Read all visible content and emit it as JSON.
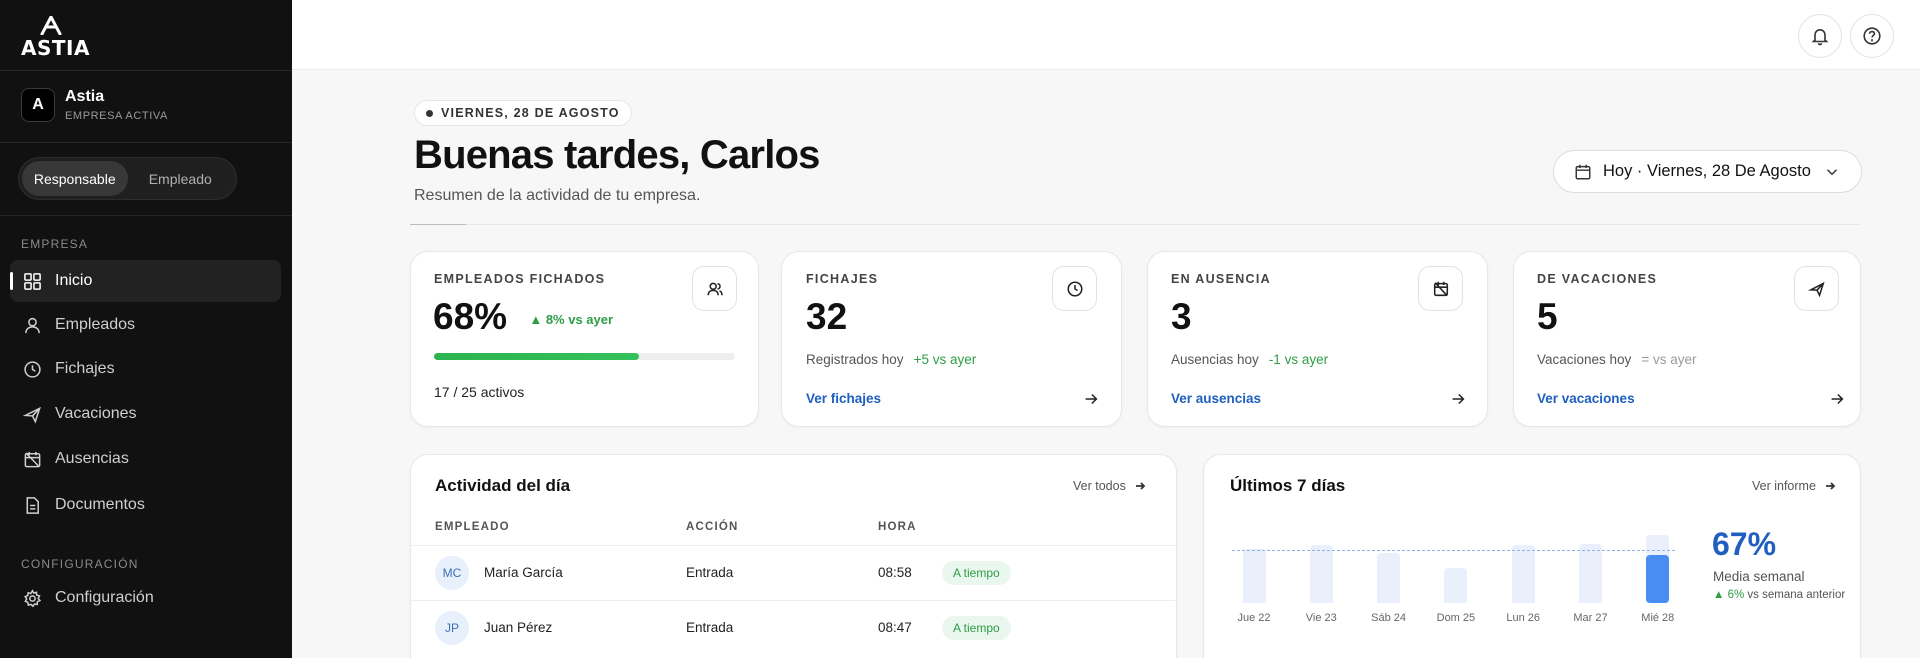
{
  "brand": {
    "logo_text": "ASTIA"
  },
  "company": {
    "avatar_letter": "A",
    "name": "Astia",
    "status": "EMPRESA ACTIVA"
  },
  "role_toggle": {
    "options": [
      "Responsable",
      "Empleado"
    ],
    "selected": "Responsable"
  },
  "sidebar": {
    "section_company": "EMPRESA",
    "items": [
      {
        "label": "Inicio",
        "icon": "grid-icon",
        "active": true
      },
      {
        "label": "Empleados",
        "icon": "user-icon"
      },
      {
        "label": "Fichajes",
        "icon": "clock-icon"
      },
      {
        "label": "Vacaciones",
        "icon": "plane-icon"
      },
      {
        "label": "Ausencias",
        "icon": "calendar-x-icon"
      },
      {
        "label": "Documentos",
        "icon": "document-icon"
      }
    ],
    "section_config": "CONFIGURACIÓN",
    "config_item": {
      "label": "Configuración",
      "icon": "gear-icon"
    }
  },
  "topbar": {
    "icons": [
      "bell-icon",
      "help-icon"
    ]
  },
  "header": {
    "date_pill": "VIERNES, 28 DE AGOSTO",
    "greeting": "Buenas tardes, Carlos",
    "subtitle": "Resumen de la actividad de tu empresa.",
    "date_select": "Hoy · Viernes, 28 De Agosto"
  },
  "kpis": {
    "employees": {
      "label": "EMPLEADOS FICHADOS",
      "value": "68%",
      "trend": "8% vs ayer",
      "progress": 0.68,
      "active": "17 / 25 activos"
    },
    "fichajes": {
      "label": "FICHAJES",
      "value": "32",
      "sub": "Registrados hoy",
      "trend": "+5 vs ayer",
      "link": "Ver fichajes"
    },
    "ausencia": {
      "label": "EN AUSENCIA",
      "value": "3",
      "sub": "Ausencias hoy",
      "trend": "-1 vs ayer",
      "link": "Ver ausencias"
    },
    "vacaciones": {
      "label": "DE VACACIONES",
      "value": "5",
      "sub": "Vacaciones hoy",
      "trend": "= vs ayer",
      "link": "Ver vacaciones"
    }
  },
  "activity": {
    "title": "Actividad del día",
    "link": "Ver todos",
    "columns": [
      "EMPLEADO",
      "ACCIÓN",
      "HORA"
    ],
    "rows": [
      {
        "initials": "MC",
        "name": "María García",
        "action": "Entrada",
        "time": "08:58",
        "status": "A tiempo"
      },
      {
        "initials": "JP",
        "name": "Juan Pérez",
        "action": "Entrada",
        "time": "08:47",
        "status": "A tiempo"
      }
    ]
  },
  "weekly": {
    "title": "Últimos 7 días",
    "link": "Ver informe",
    "average": "67%",
    "average_label": "Media semanal",
    "trend_value": "6%",
    "trend_text": "vs semana anterior"
  },
  "chart_data": {
    "type": "bar",
    "categories": [
      "Jue 22",
      "Vie 23",
      "Sáb 24",
      "Dom 25",
      "Lun 26",
      "Mar 27",
      "Mié 28"
    ],
    "values": [
      0.77,
      0.83,
      0.72,
      0.5,
      0.83,
      0.84,
      0.68
    ],
    "average_line": 0.67,
    "highlight": "Mié 28",
    "colors": {
      "bar": "#e9f0fb",
      "current": "#4a8df0",
      "average_line": "#8fb3ea"
    }
  },
  "colors": {
    "sidebar_bg": "#111111",
    "accent_blue": "#1f5fbf",
    "positive_green": "#2e9d46"
  }
}
